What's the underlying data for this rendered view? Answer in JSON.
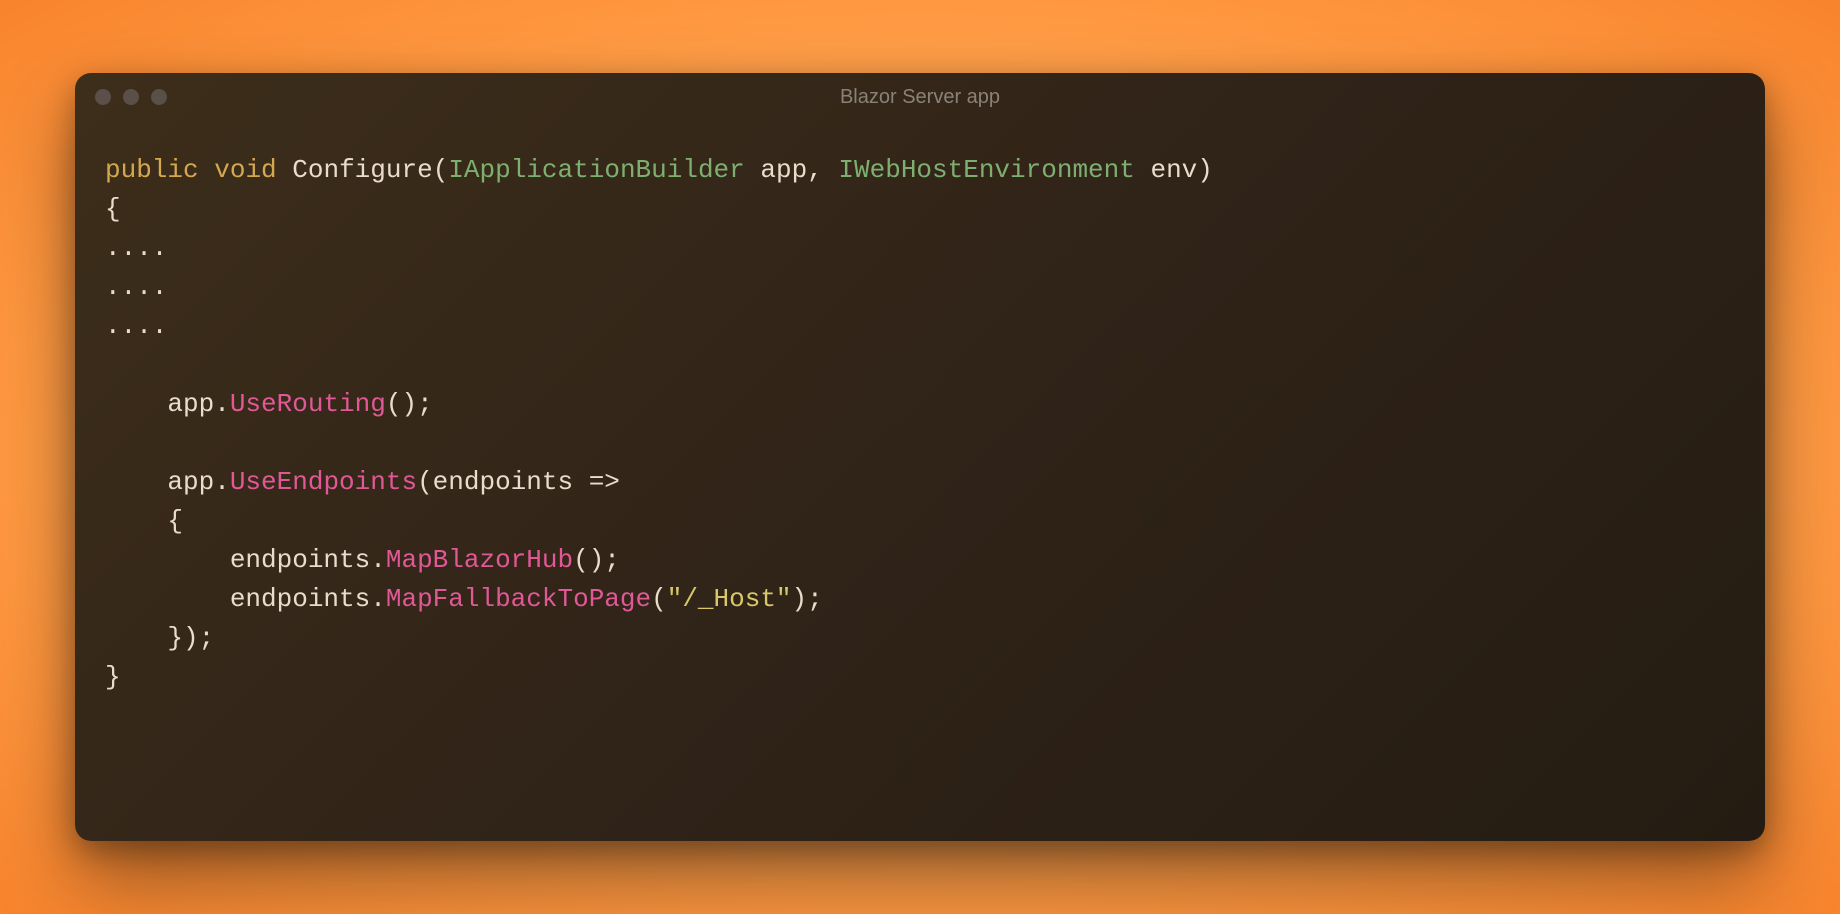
{
  "window": {
    "title": "Blazor Server app"
  },
  "code": {
    "kw_public": "public",
    "kw_void": "void",
    "fn_configure": "Configure",
    "paren_open": "(",
    "type_iappbuilder": "IApplicationBuilder",
    "param_app": " app",
    "comma_space": ", ",
    "type_iwebhostenv": "IWebHostEnvironment",
    "param_env": " env",
    "paren_close": ")",
    "brace_open": "{",
    "dots": "....",
    "app_ident": "    app",
    "dot": ".",
    "call_userouting": "UseRouting",
    "empty_parens_semi": "();",
    "call_useendpoints": "UseEndpoints",
    "lambda_head": "(endpoints =>",
    "inner_brace_open": "    {",
    "endpoints_ident": "        endpoints",
    "call_mapblazorhub": "MapBlazorHub",
    "call_mapfallback": "MapFallbackToPage",
    "open_paren": "(",
    "str_host": "\"/_Host\"",
    "close_paren_semi": ");",
    "inner_brace_close_paren": "    });",
    "brace_close": "}"
  }
}
